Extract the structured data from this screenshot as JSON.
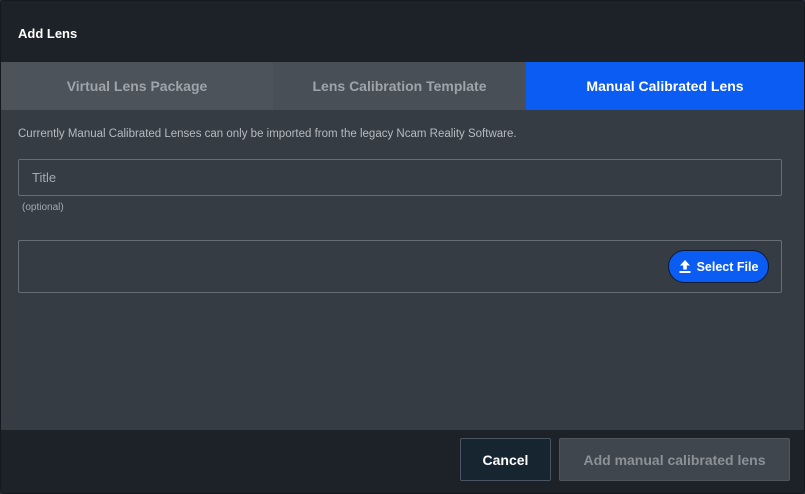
{
  "dialog": {
    "title": "Add Lens"
  },
  "tabs": [
    {
      "label": "Virtual Lens Package",
      "active": false
    },
    {
      "label": "Lens Calibration Template",
      "active": false
    },
    {
      "label": "Manual Calibrated Lens",
      "active": true
    }
  ],
  "content": {
    "info_text": "Currently Manual Calibrated Lenses can only be imported from the legacy Ncam Reality Software.",
    "title_field": {
      "value": "",
      "placeholder": "Title",
      "hint": "(optional)"
    },
    "file_picker": {
      "button_label": "Select File",
      "icon": "upload-icon"
    }
  },
  "footer": {
    "cancel_label": "Cancel",
    "submit_label": "Add manual calibrated lens",
    "submit_enabled": false
  },
  "colors": {
    "accent": "#0b5cf2",
    "header_bg": "#1c2228",
    "body_bg": "#353c44"
  }
}
